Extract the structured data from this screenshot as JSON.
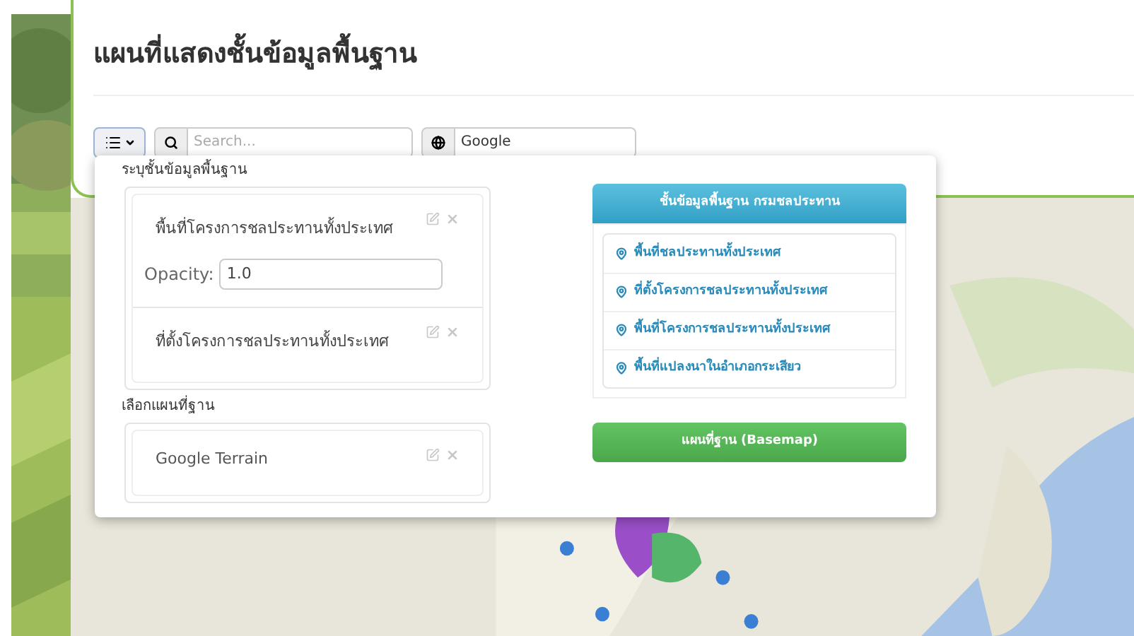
{
  "title": "แผนที่แสดงชั้นข้อมูลพื้นฐาน",
  "toolbar": {
    "search": {
      "placeholder": "Search..."
    },
    "basemap_field": {
      "value": "Google"
    }
  },
  "layers_panel": {
    "heading": "ระบุชั้นข้อมูลพื้นฐาน",
    "layers": [
      {
        "name": "พื้นที่โครงการชลประทานทั้งประเทศ",
        "expanded": true,
        "opacity_label": "Opacity:",
        "opacity": "1.0"
      },
      {
        "name": "ที่ตั้งโครงการชลประทานทั้งประเทศ",
        "expanded": false
      }
    ]
  },
  "basemap_section": {
    "heading": "เลือกแผนที่ฐาน",
    "items": [
      {
        "name": "Google Terrain"
      }
    ]
  },
  "catalog": {
    "heading": "ชั้นข้อมูลพื้นฐาน กรมชลประทาน",
    "items": [
      "พื้นที่ชลประทานทั้งประเทศ",
      "ที่ตั้งโครงการชลประทานทั้งประเทศ",
      "พื้นที่โครงการชลประทานทั้งประเทศ",
      "พื้นที่แปลงนาในอำเภอกระเสียว"
    ]
  },
  "basemap_button": "แผนที่ฐาน (Basemap)"
}
